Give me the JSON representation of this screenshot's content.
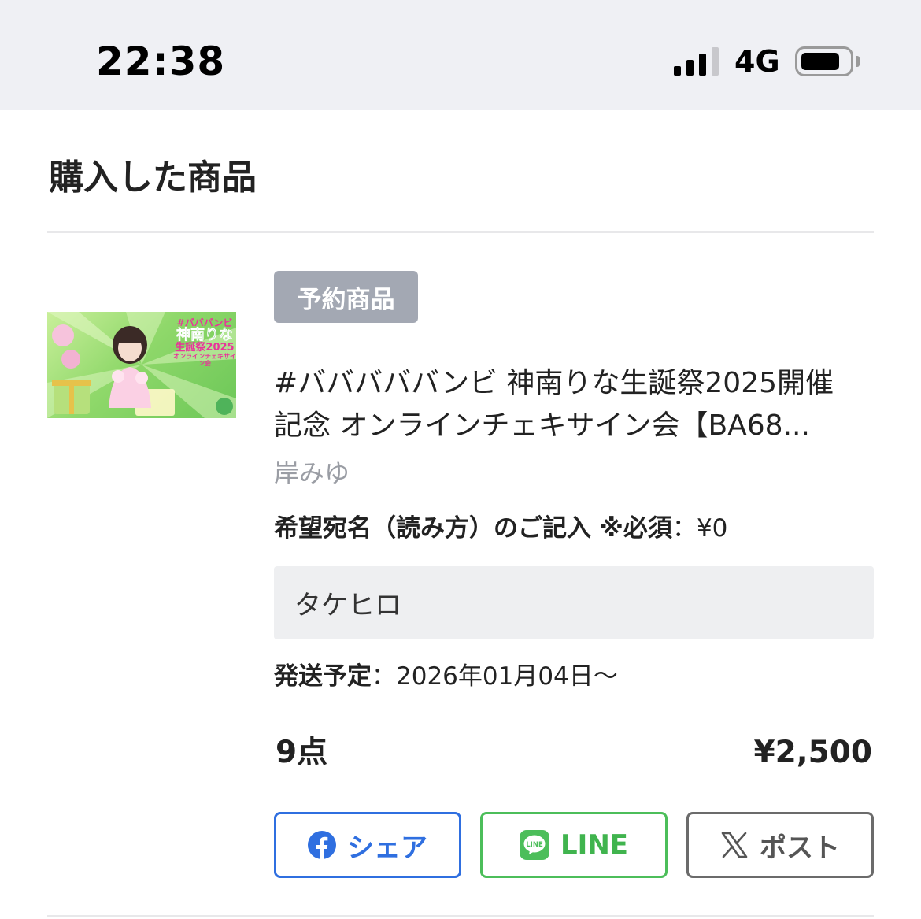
{
  "status_bar": {
    "time": "22:38",
    "network": "4G",
    "signal_bars_filled": 3,
    "signal_bars_total": 4,
    "battery_level": 0.75
  },
  "page": {
    "section_title": "購入した商品"
  },
  "product": {
    "badge": "予約商品",
    "title_line1": "#バババババンビ 神南りな生誕祭2025開催",
    "title_line2": "記念 オンラインチェキサイン会【BA68...",
    "seller": "岸みゆ",
    "option_label": "希望宛名（読み方）のご記入 ※必須",
    "option_separator": "：",
    "option_price": "¥0",
    "option_value": "タケヒロ",
    "shipping_label": "発送予定",
    "shipping_separator": "：",
    "shipping_date": "2026年01月04日〜",
    "quantity": "9点",
    "price": "¥2,500",
    "thumbnail": {
      "hashtag": "#バババンビ",
      "name": "神南りな",
      "event": "生誕祭2025",
      "subtitle": "オンラインチェキサイン会"
    }
  },
  "share": {
    "facebook_label": "シェア",
    "line_label": "LINE",
    "x_label": "ポスト",
    "icons": [
      "facebook-icon",
      "line-icon",
      "x-icon"
    ],
    "colors": {
      "facebook": "#2f6fe0",
      "line": "#4cbe5a",
      "x": "#6b6b6b"
    }
  }
}
